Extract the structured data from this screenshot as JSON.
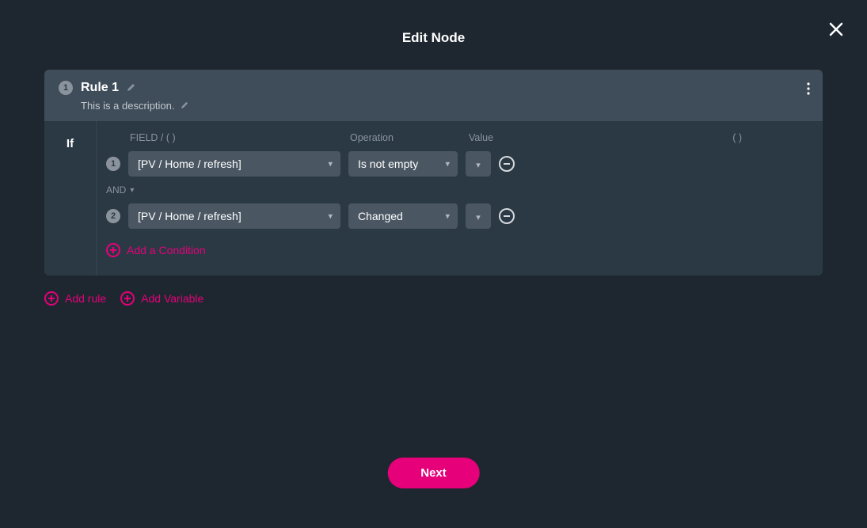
{
  "modal": {
    "title": "Edit Node",
    "nextLabel": "Next"
  },
  "rule": {
    "badge": "1",
    "title": "Rule 1",
    "description": "This is a description."
  },
  "ifLabel": "If",
  "headers": {
    "field": "FIELD / ( )",
    "operation": "Operation",
    "value": "Value",
    "paren": "( )"
  },
  "conditions": [
    {
      "num": "1",
      "field": "[PV / Home / refresh]",
      "operation": "Is not empty"
    },
    {
      "num": "2",
      "field": "[PV / Home / refresh]",
      "operation": "Changed"
    }
  ],
  "joiner": "AND",
  "addCondition": "Add a Condition",
  "addRule": "Add rule",
  "addVariable": "Add Variable"
}
